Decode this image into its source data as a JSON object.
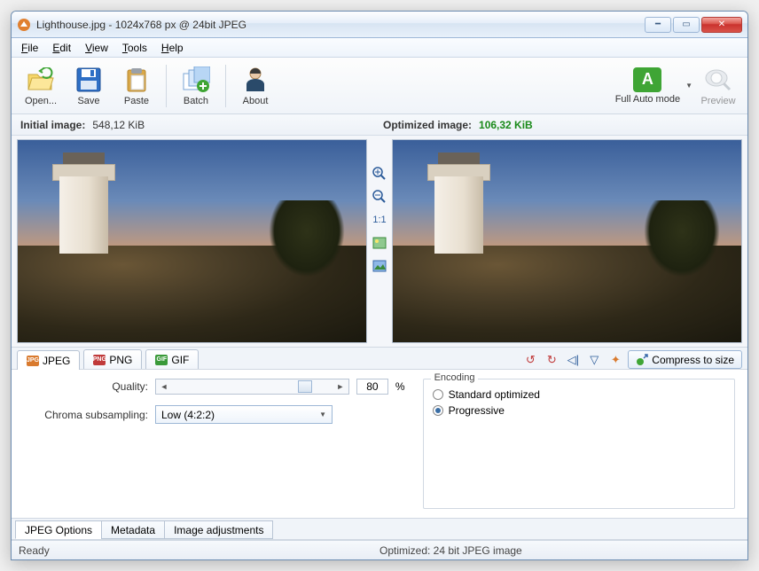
{
  "window": {
    "title": "Lighthouse.jpg - 1024x768 px @ 24bit JPEG"
  },
  "menu": {
    "file": "File",
    "edit": "Edit",
    "view": "View",
    "tools": "Tools",
    "help": "Help"
  },
  "toolbar": {
    "open": "Open...",
    "save": "Save",
    "paste": "Paste",
    "batch": "Batch",
    "about": "About",
    "automode": "Full Auto mode",
    "automode_letter": "A",
    "preview": "Preview"
  },
  "sizes": {
    "initial_label": "Initial image:",
    "initial_value": "548,12 KiB",
    "optimized_label": "Optimized image:",
    "optimized_value": "106,32 KiB"
  },
  "midtools": {
    "oneToOne": "1:1"
  },
  "format_tabs": {
    "jpeg": "JPEG",
    "png": "PNG",
    "gif": "GIF"
  },
  "toolrow": {
    "compress": "Compress to size"
  },
  "options": {
    "quality_label": "Quality:",
    "quality_value": "80",
    "quality_unit": "%",
    "chroma_label": "Chroma subsampling:",
    "chroma_value": "Low (4:2:2)",
    "encoding_legend": "Encoding",
    "encoding_standard": "Standard optimized",
    "encoding_progressive": "Progressive"
  },
  "bottom_tabs": {
    "jpeg_options": "JPEG Options",
    "metadata": "Metadata",
    "image_adjustments": "Image adjustments"
  },
  "status": {
    "left": "Ready",
    "right": "Optimized: 24 bit JPEG image"
  }
}
